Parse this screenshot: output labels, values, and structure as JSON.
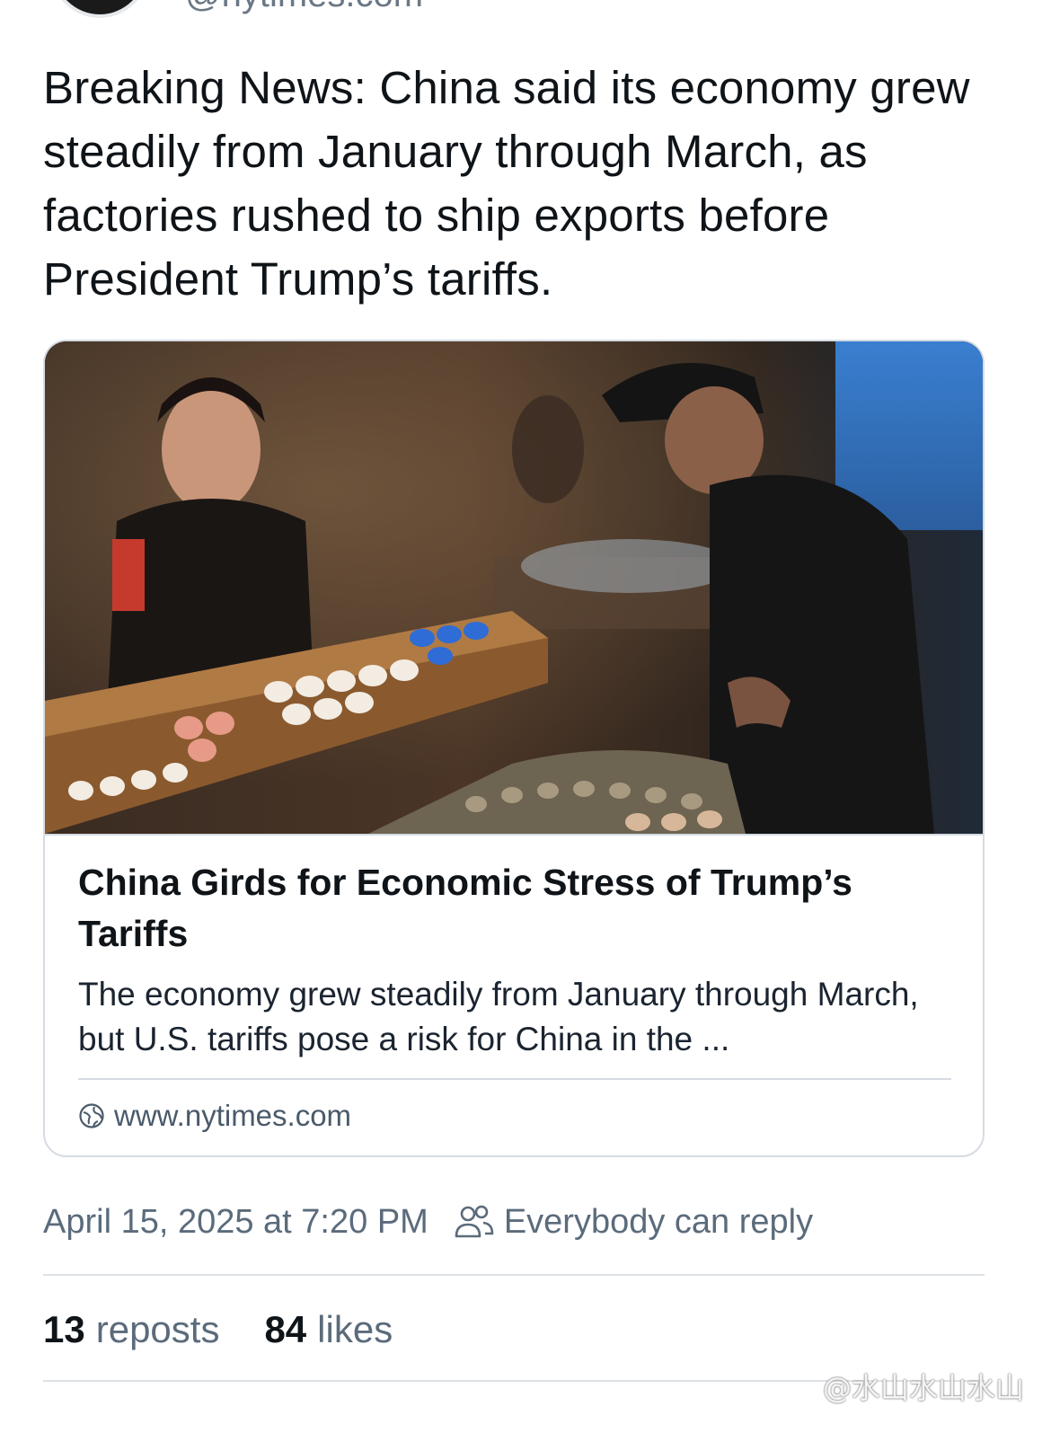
{
  "post": {
    "handle": "@nytimes.com",
    "text": "Breaking News: China said its economy grew steadily from January through March, as factories rushed to ship exports before President Trump’s tariffs."
  },
  "link_card": {
    "image_alt": "Shoppers at a market stall with eggs",
    "title": "China Girds for Economic Stress of Trump’s Tariffs",
    "description": "The economy grew steadily from January through March, but U.S. tariffs pose a risk for China in the ...",
    "domain": "www.nytimes.com",
    "domain_icon": "globe-icon"
  },
  "meta": {
    "timestamp": "April 15, 2025 at 7:20 PM",
    "reply_icon": "people-icon",
    "reply_setting": "Everybody can reply"
  },
  "stats": {
    "reposts_count": "13",
    "reposts_label": "reposts",
    "likes_count": "84",
    "likes_label": "likes"
  },
  "watermark": "@水山水山水山",
  "colors": {
    "text_primary": "#0f1419",
    "text_secondary": "#5b6b7b",
    "border": "#d5dbe2"
  }
}
